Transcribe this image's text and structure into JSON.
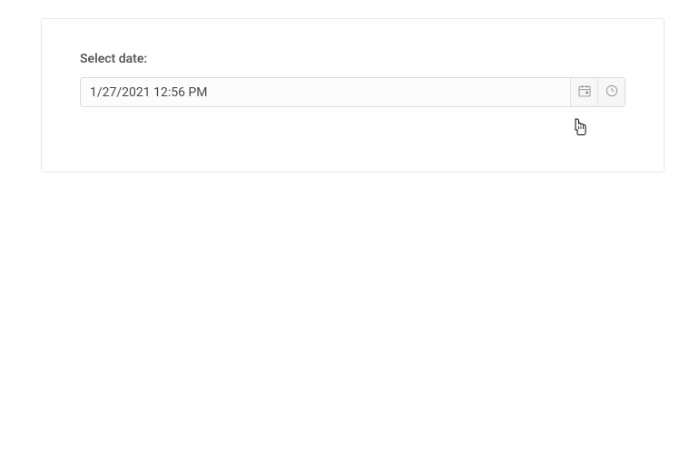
{
  "form": {
    "label": "Select date:",
    "datetime_value": "1/27/2021 12:56 PM"
  }
}
